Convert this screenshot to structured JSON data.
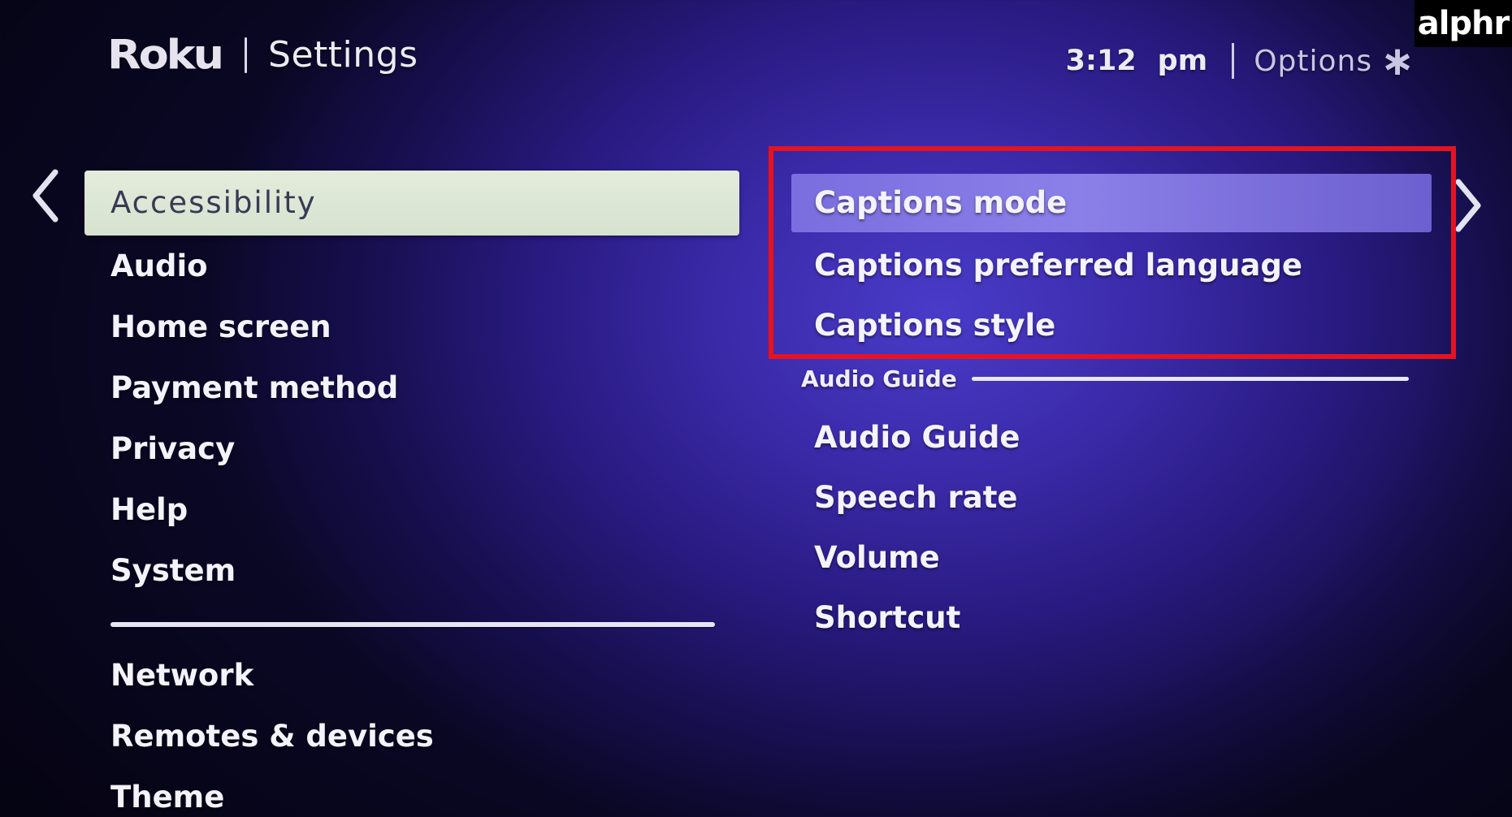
{
  "header": {
    "logo": "Roku",
    "title": "Settings",
    "time": "3:12",
    "ampm": "pm",
    "options_label": "Options",
    "options_icon": "∗"
  },
  "corner_brand": "alphr",
  "left_menu": {
    "primary": [
      {
        "label": "Accessibility",
        "selected": true
      },
      {
        "label": "Audio"
      },
      {
        "label": "Home screen"
      },
      {
        "label": "Payment method"
      },
      {
        "label": "Privacy"
      },
      {
        "label": "Help"
      },
      {
        "label": "System"
      }
    ],
    "secondary": [
      {
        "label": "Network"
      },
      {
        "label": "Remotes & devices"
      },
      {
        "label": "Theme"
      }
    ]
  },
  "right_panel": {
    "captions": [
      {
        "label": "Captions mode",
        "focused": true
      },
      {
        "label": "Captions preferred language"
      },
      {
        "label": "Captions style"
      }
    ],
    "audio_guide_header": "Audio Guide",
    "audio_guide": [
      {
        "label": "Audio Guide"
      },
      {
        "label": "Speech rate"
      },
      {
        "label": "Volume"
      },
      {
        "label": "Shortcut"
      }
    ]
  },
  "colors": {
    "highlight_box": "#e8121e",
    "selected_item_bg": "#dde6d5",
    "focused_item_bg": "#7a6ee0"
  },
  "icons": {
    "left_nav": "chevron-left-icon",
    "right_nav": "chevron-right-icon",
    "options": "asterisk-icon"
  }
}
